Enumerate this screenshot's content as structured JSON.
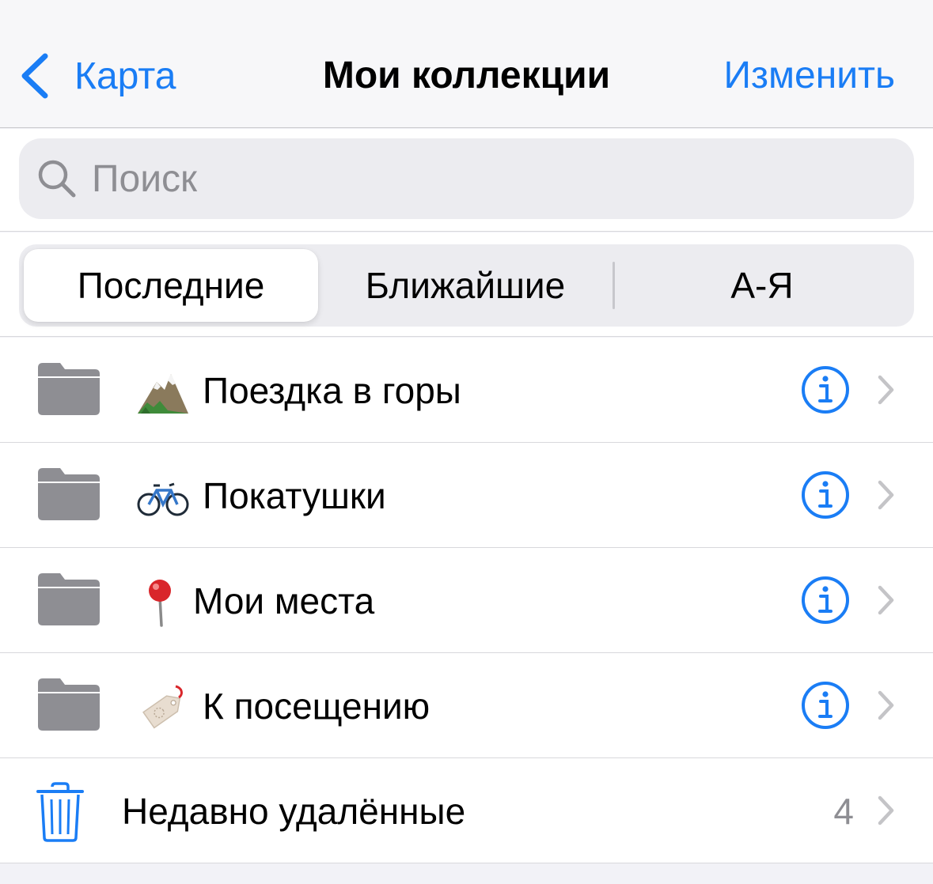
{
  "nav": {
    "back_label": "Карта",
    "title": "Мои коллекции",
    "edit_label": "Изменить"
  },
  "search": {
    "placeholder": "Поиск"
  },
  "sort": {
    "options": [
      "Последние",
      "Ближайшие",
      "А-Я"
    ],
    "selected": "Последние"
  },
  "collections": [
    {
      "icon": "mountain-emoji",
      "label": "Поездка в горы"
    },
    {
      "icon": "bicycle-emoji",
      "label": "Покатушки"
    },
    {
      "icon": "round-pushpin-emoji",
      "label": "Мои места"
    },
    {
      "icon": "label-tag-emoji",
      "label": "К посещению"
    }
  ],
  "recently_deleted": {
    "label": "Недавно удалённые",
    "count": "4"
  },
  "colors": {
    "accent": "#1a7df5",
    "folder": "#8e8e93",
    "background": "#f2f2f7",
    "secondary_text": "#8e8e93"
  }
}
